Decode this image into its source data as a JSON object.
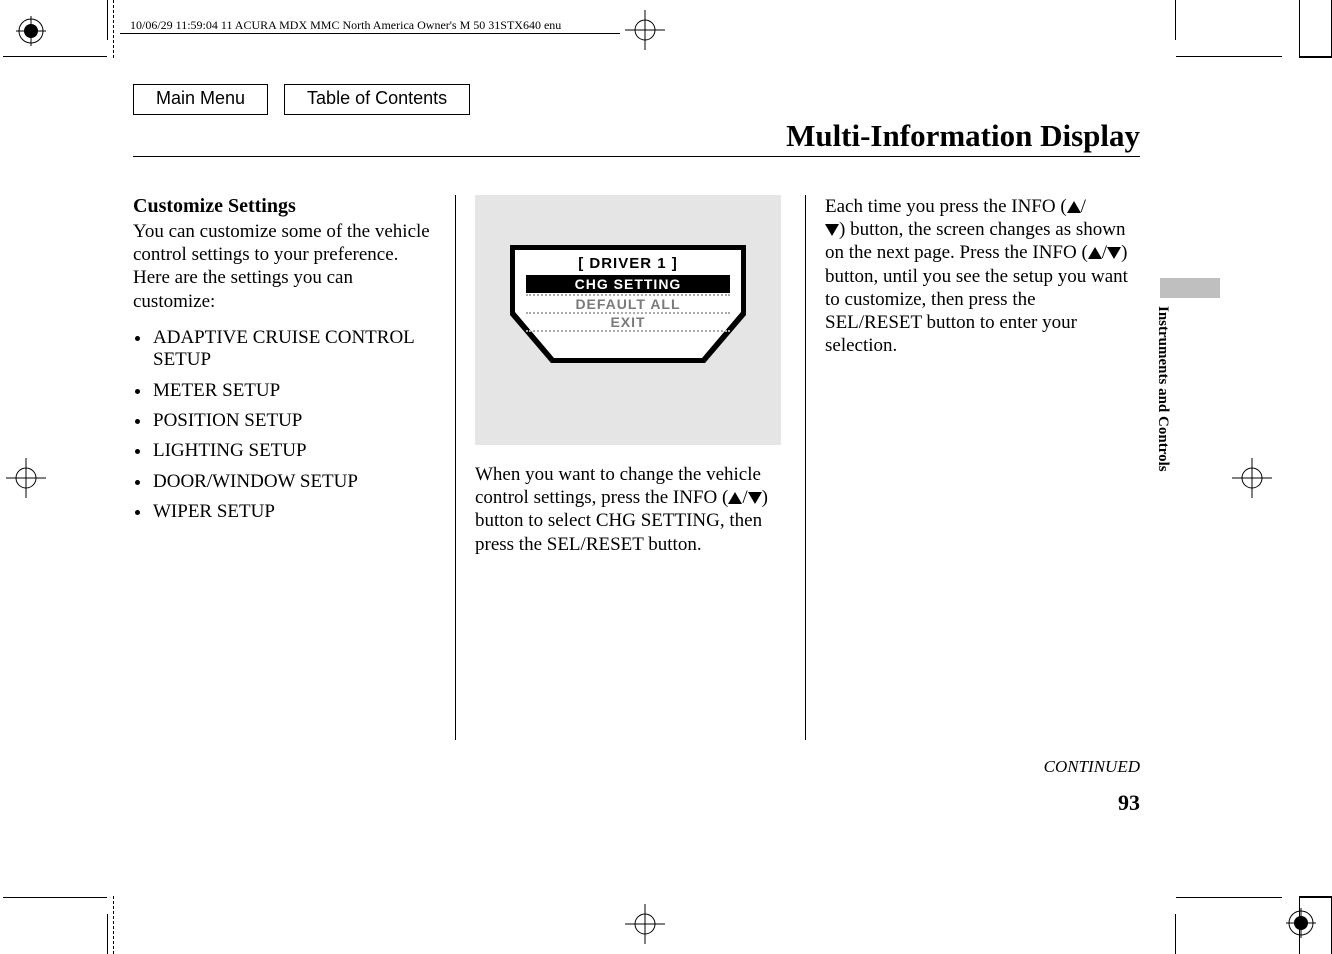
{
  "meta_line": "10/06/29 11:59:04    11 ACURA MDX MMC North America Owner's M 50 31STX640 enu",
  "nav": {
    "main_menu": "Main Menu",
    "toc": "Table of Contents"
  },
  "title": "Multi-Information Display",
  "side_tab": "Instruments and Controls",
  "col1": {
    "heading": "Customize Settings",
    "intro": "You can customize some of the vehicle control settings to your preference. Here are the settings you can customize:",
    "items": [
      "ADAPTIVE CRUISE CONTROL SETUP",
      "METER SETUP",
      "POSITION SETUP",
      "LIGHTING SETUP",
      "DOOR/WINDOW SETUP",
      "WIPER SETUP"
    ]
  },
  "display": {
    "header": "[ DRIVER 1 ]",
    "row1": "CHG SETTING",
    "row2": "DEFAULT ALL",
    "row3": "EXIT"
  },
  "col2_para_a": "When you want to change the vehicle control settings, press the INFO (",
  "col2_para_b": ") button to select CHG SETTING, then press the SEL/RESET button.",
  "col3_a": "Each time you press the INFO (",
  "col3_b": ") button, the screen changes as shown on the next page. Press the INFO (",
  "col3_c": ") button, until you see the setup you want to customize, then press the SEL/RESET button to enter your selection.",
  "continued": "CONTINUED",
  "page_number": "93"
}
